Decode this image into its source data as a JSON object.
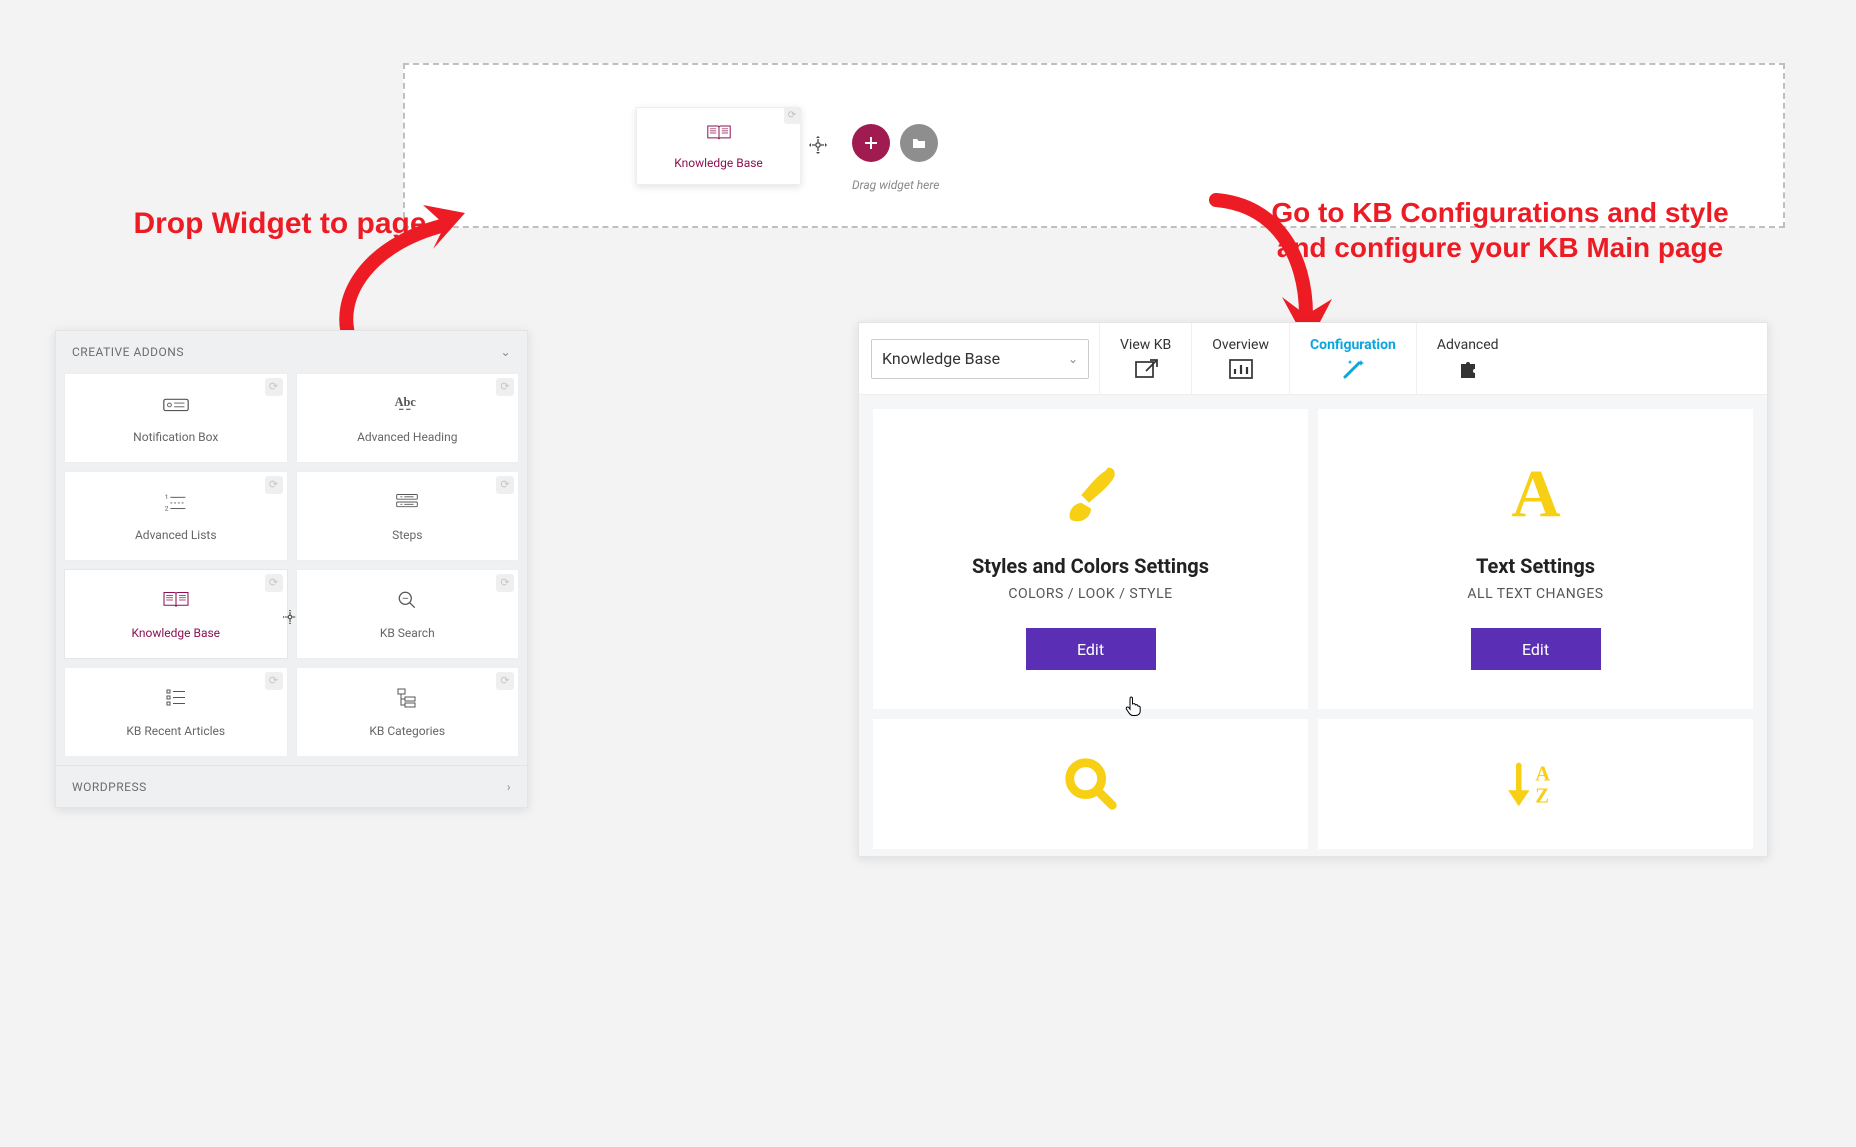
{
  "dropzone": {
    "chip_label": "Knowledge Base",
    "hint": "Drag widget here"
  },
  "callouts": {
    "one": "Drop Widget to page",
    "two": "Go to KB Configurations and style and configure your KB Main page"
  },
  "palette": {
    "header": "CREATIVE ADDONS",
    "footer": "WORDPRESS",
    "tiles": [
      {
        "label": "Notification Box",
        "icon": "notification"
      },
      {
        "label": "Advanced Heading",
        "icon": "heading"
      },
      {
        "label": "Advanced Lists",
        "icon": "list"
      },
      {
        "label": "Steps",
        "icon": "steps"
      },
      {
        "label": "Knowledge Base",
        "icon": "book",
        "active": true
      },
      {
        "label": "KB Search",
        "icon": "search"
      },
      {
        "label": "KB Recent Articles",
        "icon": "recent"
      },
      {
        "label": "KB Categories",
        "icon": "categories"
      }
    ]
  },
  "config": {
    "select_value": "Knowledge Base",
    "tabs": [
      {
        "label": "View KB",
        "icon": "external"
      },
      {
        "label": "Overview",
        "icon": "bar"
      },
      {
        "label": "Configuration",
        "icon": "wand",
        "active": true
      },
      {
        "label": "Advanced",
        "icon": "puzzle"
      }
    ],
    "cards": [
      {
        "title": "Styles and Colors Settings",
        "sub": "COLORS / LOOK / STYLE",
        "icon": "brush",
        "button": "Edit"
      },
      {
        "title": "Text Settings",
        "sub": "ALL TEXT CHANGES",
        "icon": "letter",
        "button": "Edit"
      }
    ],
    "bottom_cards": [
      {
        "icon": "search-big"
      },
      {
        "icon": "sort-az"
      }
    ]
  }
}
